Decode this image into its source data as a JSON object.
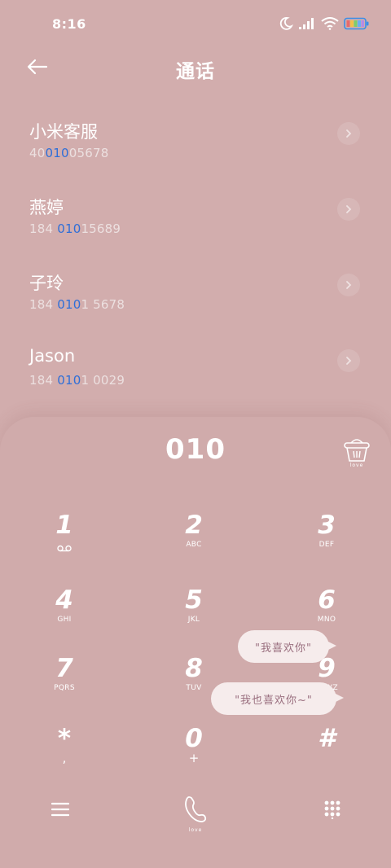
{
  "status_bar": {
    "time": "8:16",
    "icons": [
      "moon-icon",
      "signal-icon",
      "wifi-icon",
      "battery-icon"
    ]
  },
  "header": {
    "title": "通话",
    "back_icon": "arrow-left-icon"
  },
  "results": [
    {
      "name": "小米客服",
      "number_pre": "40",
      "number_match": "010",
      "number_post": "05678"
    },
    {
      "name": "燕婷",
      "number_pre": "184 ",
      "number_match": "010",
      "number_post": "15689"
    },
    {
      "name": "子玲",
      "number_pre": "184 ",
      "number_match": "010",
      "number_post": "1 5678"
    },
    {
      "name": "Jason",
      "number_pre": "184 ",
      "number_match": "010",
      "number_post": "1 0029"
    }
  ],
  "dialer": {
    "input_value": "010",
    "delete_icon": "delete-basket-icon",
    "delete_caption": "love"
  },
  "keypad": [
    {
      "digit": "1",
      "sub": "",
      "icon": "voicemail-icon"
    },
    {
      "digit": "2",
      "sub": "ABC"
    },
    {
      "digit": "3",
      "sub": "DEF"
    },
    {
      "digit": "4",
      "sub": "GHI"
    },
    {
      "digit": "5",
      "sub": "JKL"
    },
    {
      "digit": "6",
      "sub": "MNO"
    },
    {
      "digit": "7",
      "sub": "PQRS"
    },
    {
      "digit": "8",
      "sub": "TUV"
    },
    {
      "digit": "9",
      "sub": "WXYZ"
    },
    {
      "digit": "*",
      "sub": ","
    },
    {
      "digit": "0",
      "sub": "+"
    },
    {
      "digit": "#",
      "sub": ""
    }
  ],
  "bubbles": {
    "first": "\"我喜欢你\"",
    "second": "\"我也喜欢你~\""
  },
  "bottom_bar": {
    "menu_icon": "menu-icon",
    "call_icon": "call-icon",
    "call_caption": "love",
    "keypad_toggle_icon": "dialpad-icon"
  },
  "colors": {
    "background": "#d2adad",
    "match_highlight": "#2f6fd8"
  }
}
